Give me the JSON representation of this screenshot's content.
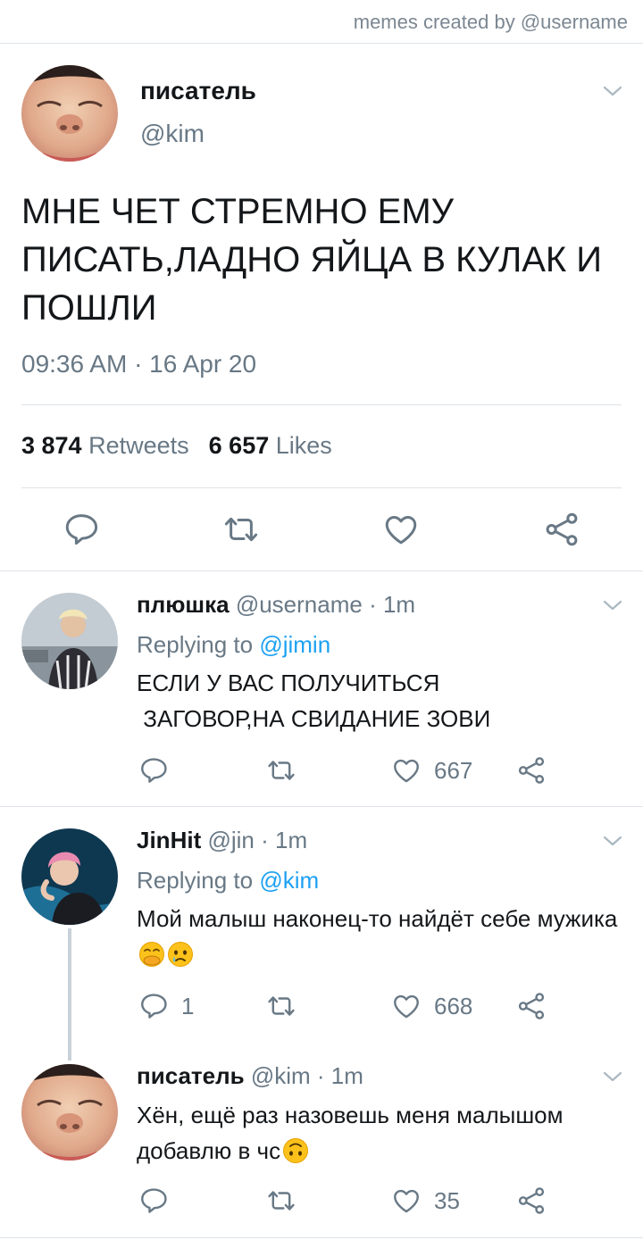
{
  "watermark": "memes created by @username",
  "tweet": {
    "name": "писатель",
    "handle": "@kim",
    "text": "МНЕ ЧЕТ СТРЕМНО ЕМУ ПИСАТЬ,ЛАДНО ЯЙЦА В КУЛАК И ПОШЛИ",
    "timestamp": "09:36 AM · 16 Apr 20",
    "retweets_count": "3 874",
    "retweets_label": "Retweets",
    "likes_count": "6 657",
    "likes_label": "Likes"
  },
  "replies": [
    {
      "name": "плюшка",
      "handle": "@username",
      "time": "· 1m",
      "replying_label": "Replying to",
      "replying_to": "@jimin",
      "text": "ЕСЛИ У ВАС ПОЛУЧИТЬСЯ\n ЗАГОВОР,НА СВИДАНИЕ ЗОВИ",
      "reply_count": "",
      "like_count": "667"
    },
    {
      "name": "JinHit",
      "handle": "@jin",
      "time": "· 1m",
      "replying_label": "Replying to",
      "replying_to": "@kim",
      "text": "Мой малыш наконец-то найдёт себе мужика",
      "emojis": [
        "hand-over-mouth-emoji",
        "crying-face-emoji"
      ],
      "reply_count": "1",
      "like_count": "668"
    },
    {
      "name": "писатель",
      "handle": "@kim",
      "time": "· 1m",
      "text": "Хён, ещё раз назовешь меня малышом добавлю в чс",
      "emojis": [
        "upside-down-face-emoji"
      ],
      "reply_count": "",
      "like_count": "35"
    }
  ],
  "icons": [
    "chevron-down-icon",
    "reply-icon",
    "retweet-icon",
    "like-icon",
    "share-icon"
  ],
  "colors": {
    "accent": "#1da1f2",
    "secondary_text": "#687885",
    "icon_gray": "#687885",
    "divider": "#dfe3e7"
  }
}
